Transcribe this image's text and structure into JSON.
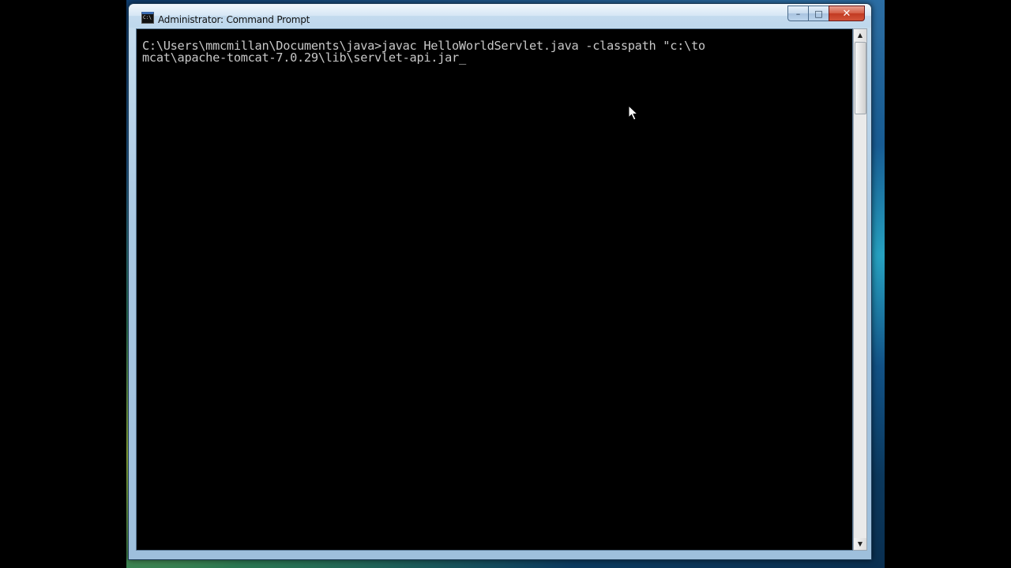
{
  "window": {
    "title": "Administrator: Command Prompt",
    "icon": "cmd-icon",
    "icon_glyph": "C:\\",
    "controls": {
      "minimize": "–",
      "maximize": "□",
      "close": "✕"
    }
  },
  "console": {
    "lines": [
      "C:\\Users\\mmcmillan\\Documents\\java>javac HelloWorldServlet.java -classpath \"c:\\to",
      "mcat\\apache-tomcat-7.0.29\\lib\\servlet-api.jar"
    ],
    "cursor": "_",
    "foreground": "#c8c8c8",
    "background": "#000000"
  },
  "scrollbar": {
    "up_arrow": "▲",
    "down_arrow": "▼"
  },
  "colors": {
    "title_bar": "#bcd6ee",
    "close_button": "#c23a22"
  }
}
